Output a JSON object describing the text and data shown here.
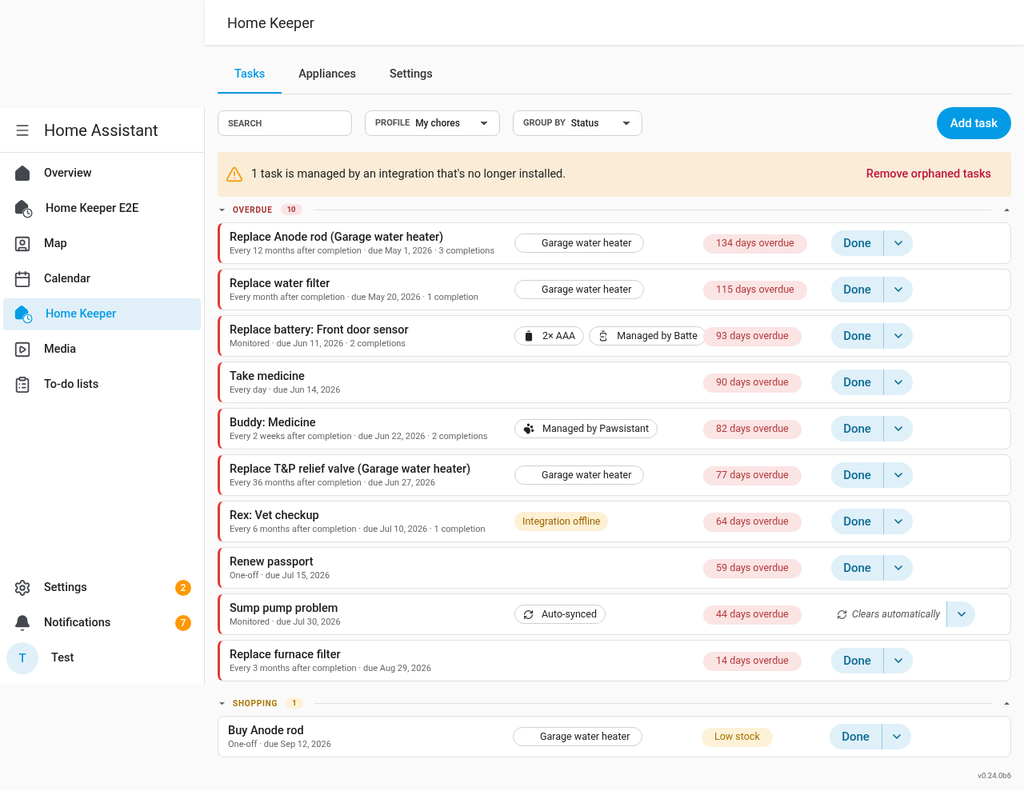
{
  "sidebar": {
    "title": "Home Assistant",
    "items": [
      {
        "label": "Overview",
        "selected": false
      },
      {
        "label": "Home Keeper E2E",
        "selected": false
      },
      {
        "label": "Map",
        "selected": false
      },
      {
        "label": "Calendar",
        "selected": false
      },
      {
        "label": "Home Keeper",
        "selected": true
      },
      {
        "label": "Media",
        "selected": false
      },
      {
        "label": "To-do lists",
        "selected": false
      }
    ],
    "bottom_items": [
      {
        "label": "Settings",
        "badge": "2"
      },
      {
        "label": "Notifications",
        "badge": "7"
      }
    ],
    "user": {
      "initial": "T",
      "name": "Test"
    }
  },
  "header": {
    "title": "Home Keeper"
  },
  "tabs": [
    {
      "label": "Tasks",
      "selected": true
    },
    {
      "label": "Appliances",
      "selected": false
    },
    {
      "label": "Settings",
      "selected": false
    }
  ],
  "toolbar": {
    "search": {
      "placeholder": "SEARCH"
    },
    "profile": {
      "label": "PROFILE",
      "value": "My chores"
    },
    "group_by": {
      "label": "GROUP BY",
      "value": "Status"
    },
    "add_button": "Add task"
  },
  "banner": {
    "message": "1 task is managed by an integration that's no longer installed.",
    "action": "Remove orphaned tasks"
  },
  "groups": [
    {
      "title": "OVERDUE",
      "count": "10",
      "kind": "overdue",
      "expanded": true,
      "tasks": [
        {
          "title": "Replace Anode rod (Garage water heater)",
          "subtitle": "Every 12 months after completion · due May 1, 2026 · 3 completions",
          "chips": [
            {
              "kind": "plain",
              "label": "Garage water heater"
            }
          ],
          "status": {
            "kind": "overdue",
            "label": "134 days overdue"
          },
          "action": {
            "kind": "done",
            "label": "Done"
          }
        },
        {
          "title": "Replace water filter",
          "subtitle": "Every month after completion · due May 20, 2026 · 1 completion",
          "chips": [
            {
              "kind": "plain",
              "label": "Garage water heater"
            }
          ],
          "status": {
            "kind": "overdue",
            "label": "115 days overdue"
          },
          "action": {
            "kind": "done",
            "label": "Done"
          }
        },
        {
          "title": "Replace battery: Front door sensor",
          "subtitle": "Monitored · due Jun 11, 2026 · 2 completions",
          "chips": [
            {
              "kind": "battery",
              "label": "2× AAA"
            },
            {
              "kind": "battery-alert",
              "label": "Managed by Batte"
            }
          ],
          "status": {
            "kind": "overdue",
            "label": "93 days overdue"
          },
          "action": {
            "kind": "done",
            "label": "Done"
          }
        },
        {
          "title": "Take medicine",
          "subtitle": "Every day · due Jun 14, 2026",
          "status": {
            "kind": "overdue",
            "label": "90 days overdue"
          },
          "action": {
            "kind": "done",
            "label": "Done"
          }
        },
        {
          "title": "Buddy: Medicine",
          "subtitle": "Every 2 weeks after completion · due Jun 22, 2026 · 2 completions",
          "chips": [
            {
              "kind": "paw",
              "label": "Managed by Pawsistant"
            }
          ],
          "status": {
            "kind": "overdue",
            "label": "82 days overdue"
          },
          "action": {
            "kind": "done",
            "label": "Done"
          }
        },
        {
          "title": "Replace T&P relief valve (Garage water heater)",
          "subtitle": "Every 36 months after completion · due Jun 27, 2026",
          "chips": [
            {
              "kind": "plain",
              "label": "Garage water heater"
            }
          ],
          "status": {
            "kind": "overdue",
            "label": "77 days overdue"
          },
          "action": {
            "kind": "done",
            "label": "Done"
          }
        },
        {
          "title": "Rex: Vet checkup",
          "subtitle": "Every 6 months after completion · due Jul 10, 2026 · 1 completion",
          "chips": [
            {
              "kind": "warning",
              "label": "Integration offline"
            }
          ],
          "status": {
            "kind": "overdue",
            "label": "64 days overdue"
          },
          "action": {
            "kind": "done",
            "label": "Done"
          }
        },
        {
          "title": "Renew passport",
          "subtitle": "One-off · due Jul 15, 2026",
          "status": {
            "kind": "overdue",
            "label": "59 days overdue"
          },
          "action": {
            "kind": "done",
            "label": "Done"
          }
        },
        {
          "title": "Sump pump problem",
          "subtitle": "Monitored · due Jul 30, 2026",
          "chips": [
            {
              "kind": "sync",
              "label": "Auto-synced"
            }
          ],
          "status": {
            "kind": "overdue",
            "label": "44 days overdue"
          },
          "action": {
            "kind": "auto",
            "label": "Clears automatically"
          }
        },
        {
          "title": "Replace furnace filter",
          "subtitle": "Every 3 months after completion · due Aug 29, 2026",
          "status": {
            "kind": "overdue",
            "label": "14 days overdue"
          },
          "action": {
            "kind": "done",
            "label": "Done"
          }
        }
      ]
    },
    {
      "title": "SHOPPING",
      "count": "1",
      "kind": "shopping",
      "expanded": true,
      "tasks": [
        {
          "title": "Buy Anode rod",
          "subtitle": "One-off · due Sep 12, 2026",
          "chips": [
            {
              "kind": "plain",
              "label": "Garage water heater"
            }
          ],
          "status": {
            "kind": "low",
            "label": "Low stock"
          },
          "action": {
            "kind": "done",
            "label": "Done"
          }
        }
      ]
    }
  ],
  "version": "v0.24.0b6"
}
